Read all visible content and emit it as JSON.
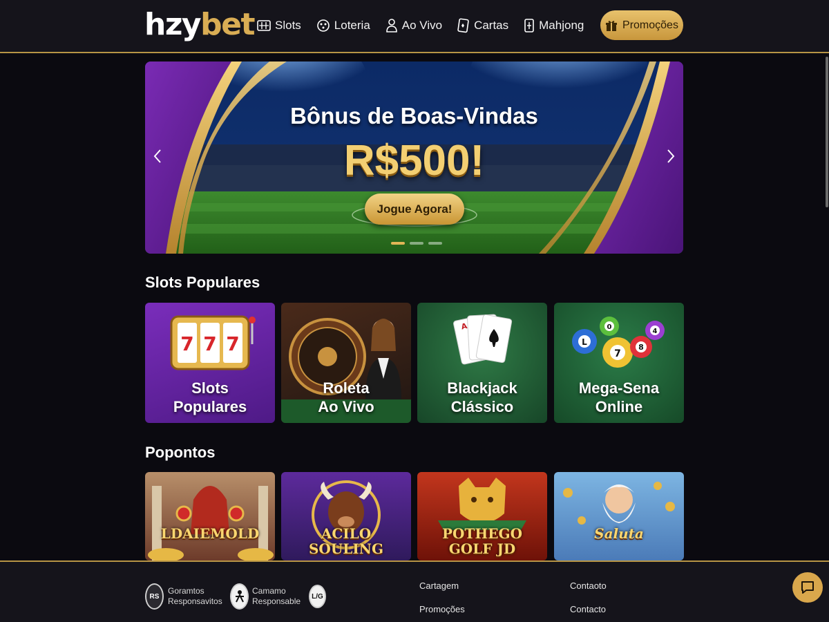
{
  "header": {
    "logo_part1": "hzy",
    "logo_part2": "bet",
    "nav": [
      {
        "label": "Slots",
        "icon": "slot-machine-icon"
      },
      {
        "label": "Loteria",
        "icon": "lottery-ball-icon"
      },
      {
        "label": "Ao Vivo",
        "icon": "live-dealer-icon"
      },
      {
        "label": "Cartas",
        "icon": "playing-card-icon"
      },
      {
        "label": "Mahjong",
        "icon": "mahjong-tile-icon"
      }
    ],
    "promo_button": "Promoções",
    "promo_icon": "gift-icon"
  },
  "banner": {
    "headline": "Bônus de Boas-Vindas",
    "amount": "R$500!",
    "cta": "Jogue Agora!",
    "slides": 3,
    "active_slide": 1
  },
  "sections": [
    {
      "title": "Slots Populares",
      "cards": [
        {
          "label_line1": "Slots",
          "label_line2": "Populares",
          "icon": "slot-machine-777-icon"
        },
        {
          "label_line1": "Roleta",
          "label_line2": "Ao Vivo",
          "icon": "roulette-wheel-icon"
        },
        {
          "label_line1": "Blackjack",
          "label_line2": "Clássico",
          "icon": "playing-cards-icon"
        },
        {
          "label_line1": "Mega-Sena",
          "label_line2": "Online",
          "icon": "bingo-balls-icon"
        }
      ]
    },
    {
      "title": "Popontos",
      "cards": [
        {
          "title_line1": "LDAIEMOLD",
          "title_line2": ""
        },
        {
          "title_line1": "ACILO",
          "title_line2": "SOULING"
        },
        {
          "title_line1": "POTHEGO",
          "title_line2": "GOLF JD"
        },
        {
          "title_line1": "Saluta",
          "title_line2": ""
        }
      ]
    }
  ],
  "footer": {
    "badges": [
      {
        "line1": "Goramtos",
        "line2": "Responsavitos",
        "icon_text": "RS"
      },
      {
        "line1": "Camamo",
        "line2": "Responsable",
        "icon_text": ""
      },
      {
        "line1": "",
        "line2": "",
        "icon_text": "L/G"
      }
    ],
    "links_col1": [
      "Cartagem",
      "Promoções"
    ],
    "links_col2": [
      "Contaoto",
      "Contacto"
    ]
  },
  "colors": {
    "accent_gold": "#d9ad54",
    "background": "#0b0a10",
    "header_bg": "#15141b"
  }
}
